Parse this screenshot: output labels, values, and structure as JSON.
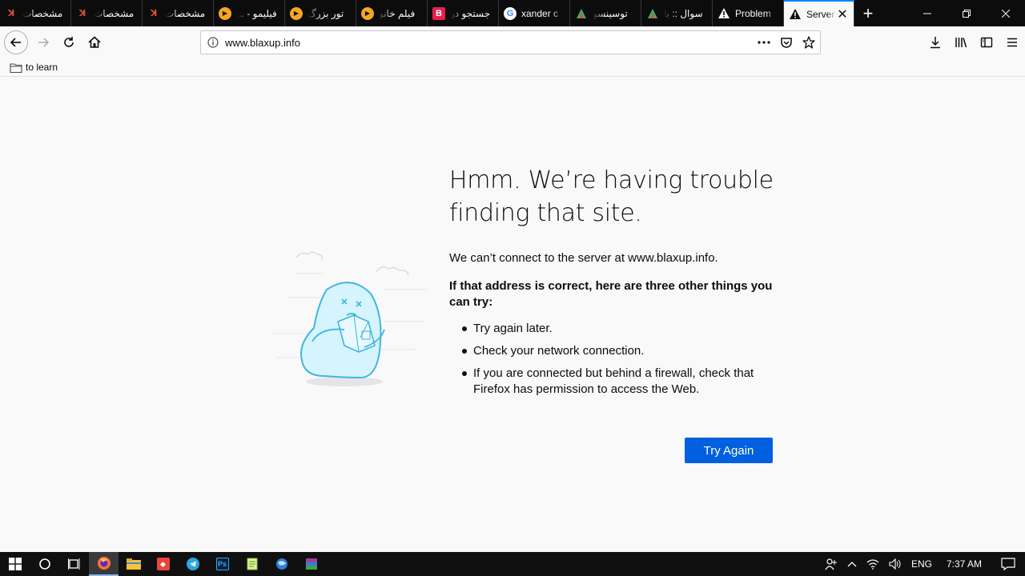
{
  "tabs": [
    {
      "label": "مشخصات",
      "icon": "k-logo-icon",
      "color": "#e04e39",
      "dir": "rtl"
    },
    {
      "label": "مشخصات",
      "icon": "k-logo-icon",
      "color": "#e04e39",
      "dir": "rtl"
    },
    {
      "label": "مشخصات",
      "icon": "k-logo-icon",
      "color": "#e04e39",
      "dir": "rtl"
    },
    {
      "label": "فیلیمو - ...",
      "icon": "filimo-play-icon",
      "color": "#f5a623",
      "dir": "rtl"
    },
    {
      "label": "تور بزرگ",
      "icon": "filimo-play-icon",
      "color": "#f5a623",
      "dir": "rtl"
    },
    {
      "label": "فیلم خانو",
      "icon": "filimo-play-icon",
      "color": "#f5a623",
      "dir": "rtl"
    },
    {
      "label": "جستجو در",
      "icon": "b-logo-icon",
      "color": "#e81e4b",
      "dir": "rtl"
    },
    {
      "label": "xander c",
      "icon": "google-icon",
      "color": "#ffffff",
      "dir": "ltr"
    },
    {
      "label": "توسینسو",
      "icon": "tosinso-icon",
      "color": "#2bb673",
      "dir": "rtl"
    },
    {
      "label": "سوال :: با",
      "icon": "tosinso-icon",
      "color": "#2bb673",
      "dir": "rtl"
    },
    {
      "label": "Problem",
      "icon": "warning-icon",
      "color": "#f9f9fa",
      "dir": "ltr"
    }
  ],
  "active_tab": {
    "label": "Server",
    "icon": "warning-icon"
  },
  "url": "www.blaxup.info",
  "bookmarks": [
    {
      "label": "to learn"
    }
  ],
  "error": {
    "title": "Hmm. We’re having trouble finding that site.",
    "desc": "We can’t connect to the server at www.blaxup.info.",
    "heading": "If that address is correct, here are three other things you can try:",
    "items": [
      "Try again later.",
      "Check your network connection.",
      "If you are connected but behind a firewall, check that Firefox has permission to access the Web."
    ],
    "button": "Try Again"
  },
  "taskbar": {
    "lang": "ENG",
    "time": "7:37 AM"
  },
  "colors": {
    "accent": "#0060df",
    "tabstrip": "#0c0c0d",
    "active_tab_line": "#0a84ff"
  }
}
